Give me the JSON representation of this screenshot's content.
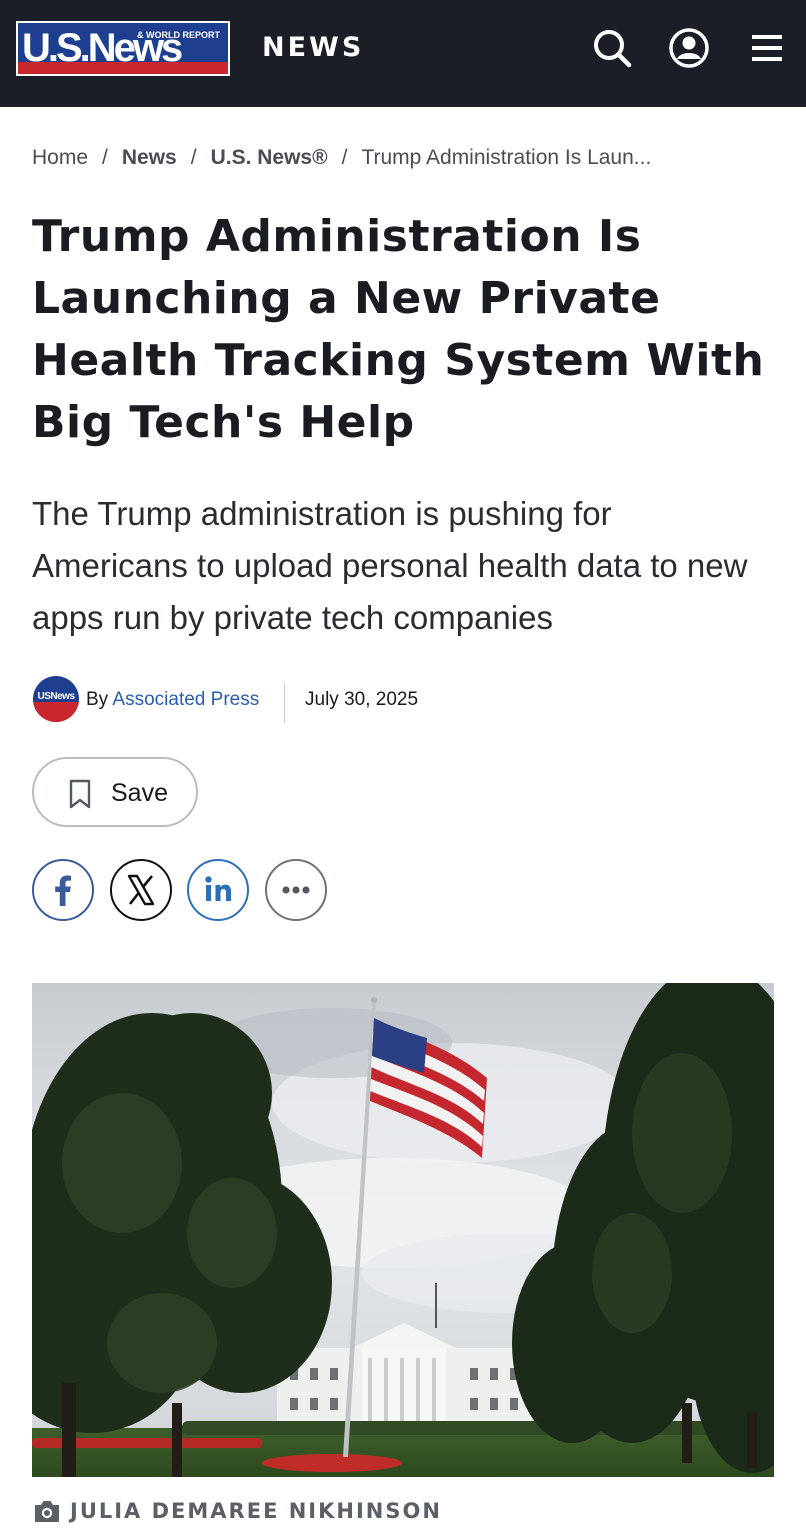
{
  "header": {
    "logo_wordmark": "U.S.News",
    "logo_subtext": "& WORLD REPORT",
    "section": "NEWS",
    "icons": [
      "search-icon",
      "account-icon",
      "menu-icon"
    ],
    "background_color": "#1b1e27"
  },
  "breadcrumb": {
    "items": [
      "Home",
      "News",
      "U.S. News®",
      "Trump Administration Is Laun..."
    ],
    "separator": "/"
  },
  "article": {
    "headline": "Trump Administration Is Launching a New Private Health Tracking System With Big Tech's Help",
    "dek": "The Trump administration is pushing for Americans to upload personal health data to new apps run by private tech companies",
    "avatar_text": "USNews",
    "byline_prefix": "By",
    "author": "Associated Press",
    "date": "July 30, 2025",
    "save_label": "Save",
    "share_icons": [
      "facebook-icon",
      "x-icon",
      "linkedin-icon",
      "more-icon"
    ],
    "photo_credit": "JULIA DEMAREE NIKHINSON"
  },
  "colors": {
    "brand_blue": "#1e3f8f",
    "brand_red": "#c8282d",
    "link": "#2a5db0",
    "facebook": "#3b5a9a",
    "linkedin": "#2d6fb7"
  }
}
